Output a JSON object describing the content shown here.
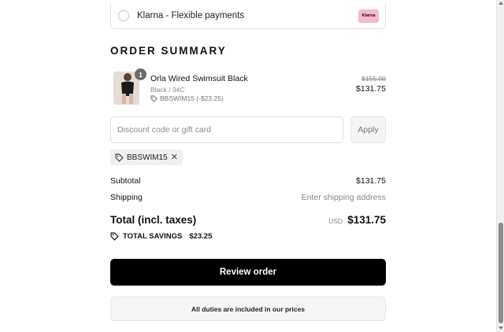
{
  "payment": {
    "option_label": "Klarna - Flexible payments",
    "badge_text": "Klarna",
    "badge_color": "#f6b8cf"
  },
  "summary": {
    "title": "ORDER SUMMARY"
  },
  "product": {
    "quantity": "1",
    "name": "Orla Wired Swimsuit Black",
    "variant": "Black / 34C",
    "discount_line": "BBSWIM15 (-$23.25)",
    "original_price": "$155.00",
    "price": "$131.75"
  },
  "discount": {
    "placeholder": "Discount code or gift card",
    "value": "",
    "apply_label": "Apply",
    "applied_code": "BBSWIM15"
  },
  "totals": {
    "subtotal_label": "Subtotal",
    "subtotal_value": "$131.75",
    "shipping_label": "Shipping",
    "shipping_value": "Enter shipping address",
    "total_label": "Total (incl. taxes)",
    "currency": "USD",
    "total_value": "$131.75",
    "savings_label": "TOTAL SAVINGS",
    "savings_value": "$23.25"
  },
  "actions": {
    "review_label": "Review order"
  },
  "notice": {
    "duties_text": "All duties are included in our prices"
  },
  "icons": {
    "radio": "radio-unchecked-icon",
    "tag": "tag-icon",
    "remove": "close-icon",
    "scroll_up": "scroll-up-arrow-icon",
    "scroll_down": "scroll-down-arrow-icon"
  },
  "colors": {
    "primary_button": "#000000",
    "klarna_pink": "#f6b8cf"
  }
}
